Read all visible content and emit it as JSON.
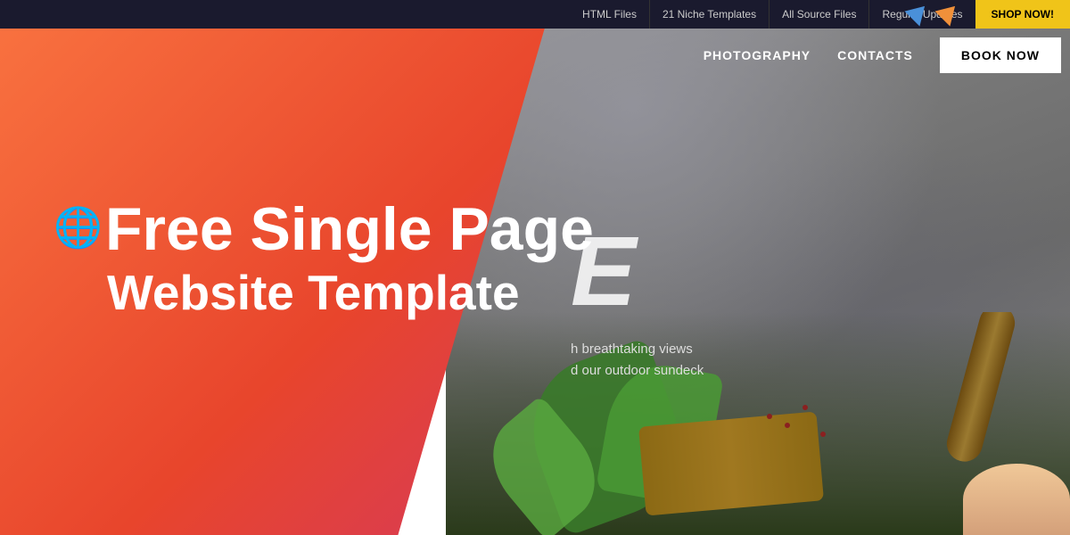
{
  "topBanner": {
    "items": [
      {
        "id": "html-files",
        "label": "HTML Files"
      },
      {
        "id": "niche-templates",
        "label": "21 Niche Templates"
      },
      {
        "id": "source-files",
        "label": "All Source Files"
      },
      {
        "id": "regular-updates",
        "label": "Regular Updates"
      }
    ],
    "shopNowLabel": "SHOP NOW!"
  },
  "nav": {
    "items": [
      {
        "id": "photography",
        "label": "PHOTOGRAPHY"
      },
      {
        "id": "contacts",
        "label": "CONTACTS"
      }
    ],
    "bookNowLabel": "BOOK NOW"
  },
  "leftPanel": {
    "titleLine1": "Free Single Page",
    "titleLine2": "Website Template",
    "globeEmoji": "🌐"
  },
  "rightPanel": {
    "bigLetters": "E",
    "subLine1": "h breathtaking views",
    "subLine2": "d our outdoor sundeck"
  },
  "colors": {
    "gradientStart": "#f97340",
    "gradientEnd": "#d63a5a",
    "bannerBg": "#1a1a2e",
    "shopNowBg": "#f0c419",
    "stoneBg": "#888888"
  }
}
